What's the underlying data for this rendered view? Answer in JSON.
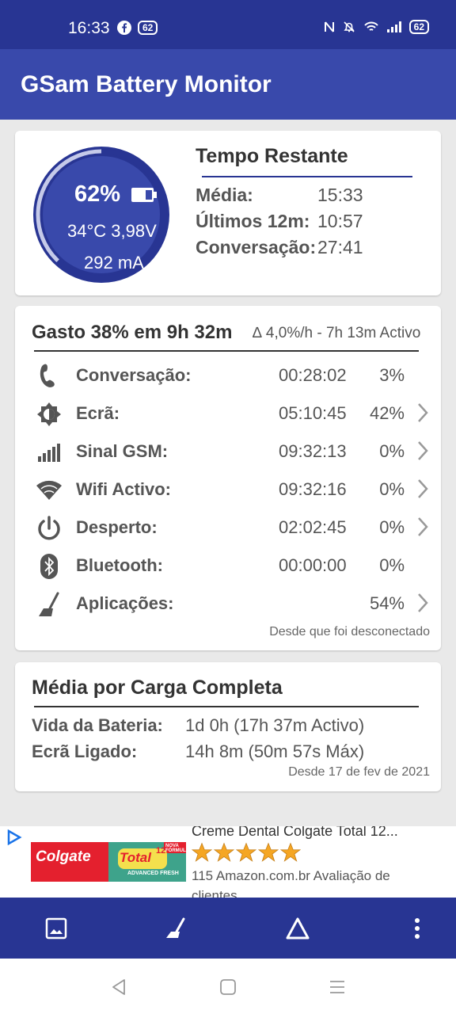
{
  "status_bar": {
    "time": "16:33",
    "notif_badge": "62",
    "battery_badge": "62"
  },
  "app": {
    "title": "GSam Battery Monitor"
  },
  "battery": {
    "percent": "62%",
    "temp_voltage": "34°C  3,98V",
    "current": "292 mA",
    "level": 0.62
  },
  "remaining": {
    "title": "Tempo Restante",
    "rows": [
      {
        "label": "Média:",
        "value": "15:33"
      },
      {
        "label": "Últimos 12m:",
        "value": "10:57"
      },
      {
        "label": "Conversação:",
        "value": "27:41"
      }
    ]
  },
  "spent": {
    "title": "Gasto 38% em 9h 32m",
    "subtitle": "∆ 4,0%/h - 7h 13m Activo",
    "rows": [
      {
        "icon": "phone-icon",
        "label": "Conversação:",
        "time": "00:28:02",
        "pct": "3%"
      },
      {
        "icon": "screen-brightness-icon",
        "label": "Ecrã:",
        "time": "05:10:45",
        "pct": "42%"
      },
      {
        "icon": "signal-bars-icon",
        "label": "Sinal GSM:",
        "time": "09:32:13",
        "pct": "0%"
      },
      {
        "icon": "wifi-icon",
        "label": "Wifi Activo:",
        "time": "09:32:16",
        "pct": "0%"
      },
      {
        "icon": "power-icon",
        "label": "Desperto:",
        "time": "02:02:45",
        "pct": "0%"
      },
      {
        "icon": "bluetooth-icon",
        "label": "Bluetooth:",
        "time": "00:00:00",
        "pct": "0%"
      },
      {
        "icon": "broom-icon",
        "label": "Aplicações:",
        "time": "",
        "pct": "54%"
      }
    ],
    "footnote": "Desde que foi desconectado"
  },
  "average": {
    "title": "Média por Carga Completa",
    "rows": [
      {
        "label": "Vida da Bateria:",
        "value": "1d 0h (17h 37m Activo)"
      },
      {
        "label": "Ecrã Ligado:",
        "value": "14h 8m (50m 57s Máx)"
      }
    ],
    "footnote": "Desde 17 de fev de 2021"
  },
  "ad": {
    "title": "Creme Dental Colgate Total 12...",
    "rating_text": "115 Amazon.com.br Avaliação de",
    "extra_text": "clientes",
    "stars": 5,
    "brand": "Colgate",
    "product_line": "Total",
    "product_num": "12",
    "variant": "ADVANCED FRESH",
    "tag": "NOVA FÓRMULA"
  },
  "colors": {
    "primary": "#3949ab",
    "primary_dark": "#283593",
    "gauge_bg": "#3949ab",
    "gauge_ring": "#283593",
    "accent_star": "#f5a623"
  }
}
